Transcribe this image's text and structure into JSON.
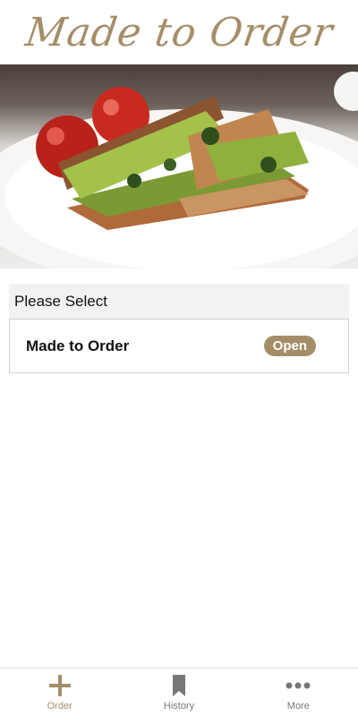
{
  "header": {
    "title": "Made to Order"
  },
  "select": {
    "heading": "Please Select",
    "options": [
      {
        "label": "Made to Order",
        "status": "Open"
      }
    ]
  },
  "nav": {
    "items": [
      {
        "label": "Order",
        "icon": "plus-icon",
        "active": true
      },
      {
        "label": "History",
        "icon": "bookmark-icon",
        "active": false
      },
      {
        "label": "More",
        "icon": "more-dots-icon",
        "active": false
      }
    ]
  },
  "colors": {
    "accent": "#a48e68",
    "inactive": "#777777",
    "panel": "#f2f2f2"
  }
}
